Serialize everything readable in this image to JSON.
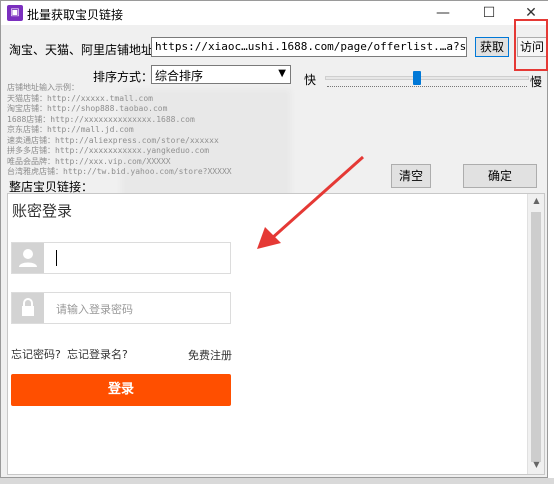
{
  "window": {
    "title": "批量获取宝贝链接",
    "minimize": "—",
    "maximize": "☐",
    "close": "✕"
  },
  "shop_url": {
    "label": "淘宝、天猫、阿里店铺地址：",
    "value": "https://xiaoc…ushi.1688.com/page/offerlist.…a?spm=…a.5.",
    "fetch_label": "获取",
    "visit_label": "访问"
  },
  "sort": {
    "label": "排序方式：",
    "selected": "综合排序"
  },
  "speed": {
    "fast_label": "快",
    "slow_label": "慢",
    "level": 0.45
  },
  "hints": [
    "店铺地址输入示例：",
    "天猫店铺：http://xxxxx.tmall.com",
    "淘宝店铺：http://shop888.taobao.com",
    "1688店铺：http://xxxxxxxxxxxxxx.1688.com",
    "京东店铺：http://mall.jd.com",
    "速卖通店铺：http://aliexpress.com/store/xxxxxx",
    "拼多多店铺：http://xxxxxxxxxxx.yangkeduo.com",
    "唯品会品牌：http://xxx.vip.com/XXXXX",
    "台湾雅虎店铺：http://tw.bid.yahoo.com/store?XXXXX"
  ],
  "buttons": {
    "clear_label": "清空",
    "confirm_label": "确定"
  },
  "shop_links_label": "整店宝贝链接：",
  "login": {
    "title": "账密登录",
    "password_placeholder": "请输入登录密码",
    "forgot_password": "忘记密码?",
    "forgot_username": "忘记登录名?",
    "register": "免费注册",
    "login_button": "登录"
  },
  "colors": {
    "login_accent": "#ff4f00",
    "highlight_red": "#e53935",
    "slider_blue": "#0078d7"
  }
}
